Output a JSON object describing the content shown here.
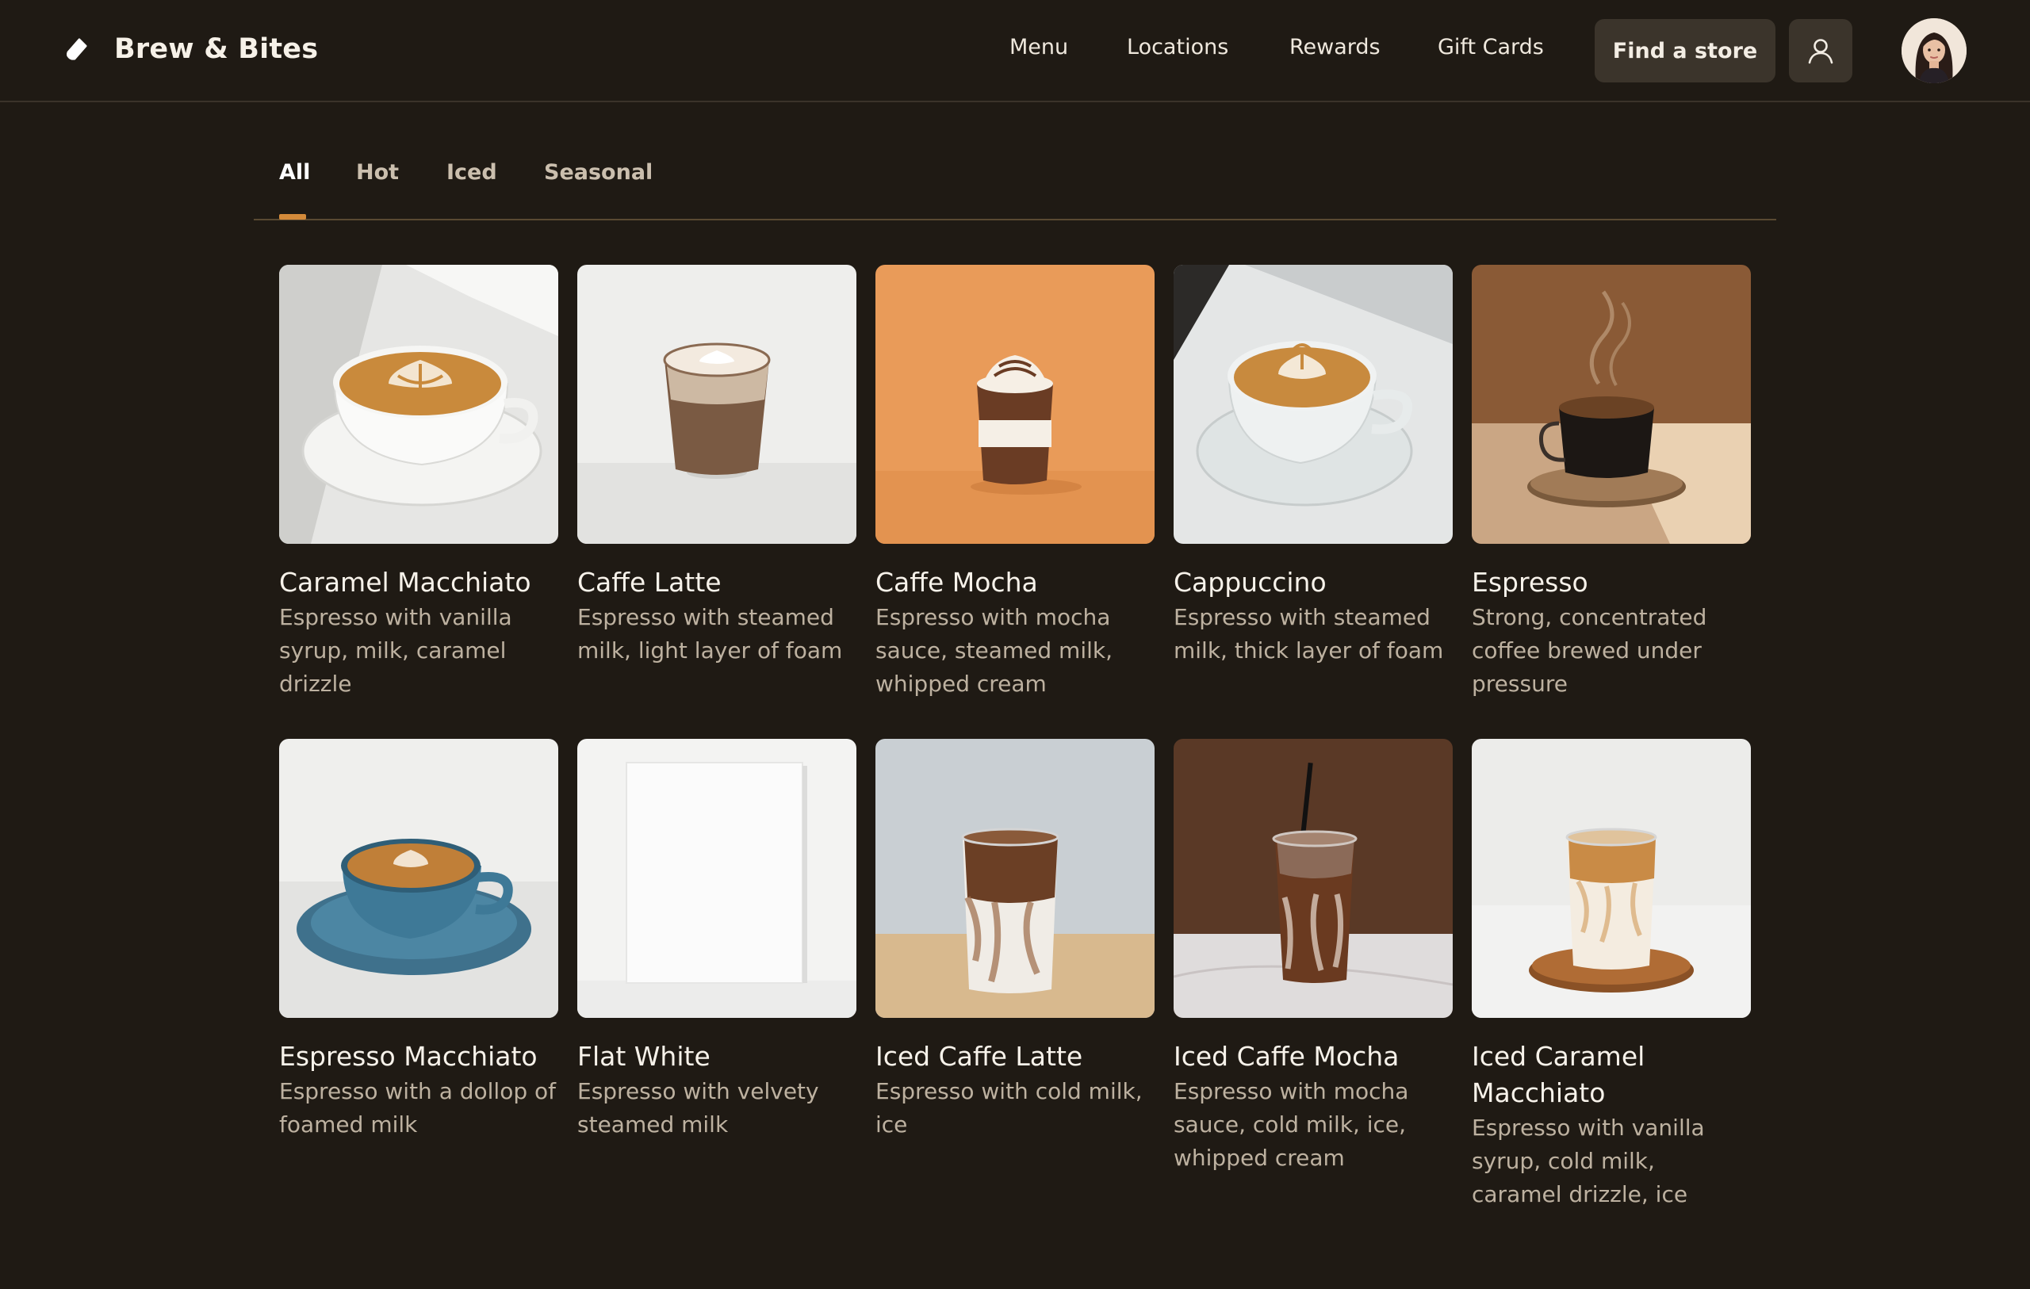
{
  "header": {
    "brand": "Brew & Bites",
    "nav": [
      "Menu",
      "Locations",
      "Rewards",
      "Gift Cards"
    ],
    "find_store": "Find a store"
  },
  "tabs": [
    "All",
    "Hot",
    "Iced",
    "Seasonal"
  ],
  "active_tab": "All",
  "colors": {
    "background": "#1f1a14",
    "accent": "#d38a3a",
    "button": "#3b342b"
  },
  "products": [
    {
      "name": "Caramel Macchiato",
      "description": "Espresso with vanilla syrup, milk, caramel drizzle"
    },
    {
      "name": "Caffe Latte",
      "description": "Espresso with steamed milk, light layer of foam"
    },
    {
      "name": "Caffe Mocha",
      "description": "Espresso with mocha sauce, steamed milk, whipped cream"
    },
    {
      "name": "Cappuccino",
      "description": "Espresso with steamed milk, thick layer of foam"
    },
    {
      "name": "Espresso",
      "description": "Strong, concentrated coffee brewed under pressure"
    },
    {
      "name": "Espresso Macchiato",
      "description": "Espresso with a dollop of foamed milk"
    },
    {
      "name": "Flat White",
      "description": "Espresso with velvety steamed milk"
    },
    {
      "name": "Iced Caffe Latte",
      "description": "Espresso with cold milk, ice"
    },
    {
      "name": "Iced Caffe Mocha",
      "description": "Espresso with mocha sauce, cold milk, ice, whipped cream"
    },
    {
      "name": "Iced Caramel Macchiato",
      "description": "Espresso with vanilla syrup, cold milk, caramel drizzle, ice"
    }
  ]
}
